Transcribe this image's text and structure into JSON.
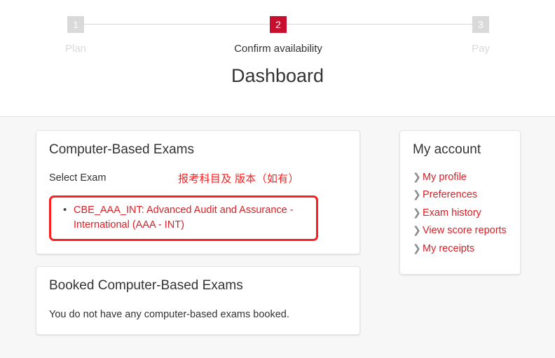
{
  "stepper": {
    "steps": [
      {
        "number": "1",
        "label": "Plan",
        "active": false
      },
      {
        "number": "2",
        "label": "Confirm availability",
        "active": true
      },
      {
        "number": "3",
        "label": "Pay",
        "active": false
      }
    ]
  },
  "page": {
    "title": "Dashboard"
  },
  "exams_card": {
    "title": "Computer-Based Exams",
    "select_label": "Select Exam",
    "annotation": "报考科目及 版本（如有）",
    "items": [
      "CBE_AAA_INT: Advanced Audit and Assurance - International (AAA - INT)"
    ]
  },
  "booked_card": {
    "title": "Booked Computer-Based Exams",
    "empty_text": "You do not have any computer-based exams booked."
  },
  "account_card": {
    "title": "My account",
    "items": [
      {
        "label": "My profile",
        "icon": "chevron-right-icon"
      },
      {
        "label": "Preferences",
        "icon": "chevron-right-icon"
      },
      {
        "label": "Exam history",
        "icon": "chevron-right-icon"
      },
      {
        "label": "View score reports",
        "icon": "chevron-right-icon"
      },
      {
        "label": "My receipts",
        "icon": "chevron-right-icon"
      }
    ]
  },
  "colors": {
    "brand_red": "#c8102e",
    "link_red": "#d81f26",
    "annotation_red": "#fb1f1f",
    "inactive_gray": "#d9d9d9",
    "page_background": "#f7f7f7",
    "card_background": "#ffffff",
    "text": "#333333"
  },
  "icons": {
    "chevron_right": "❯"
  }
}
